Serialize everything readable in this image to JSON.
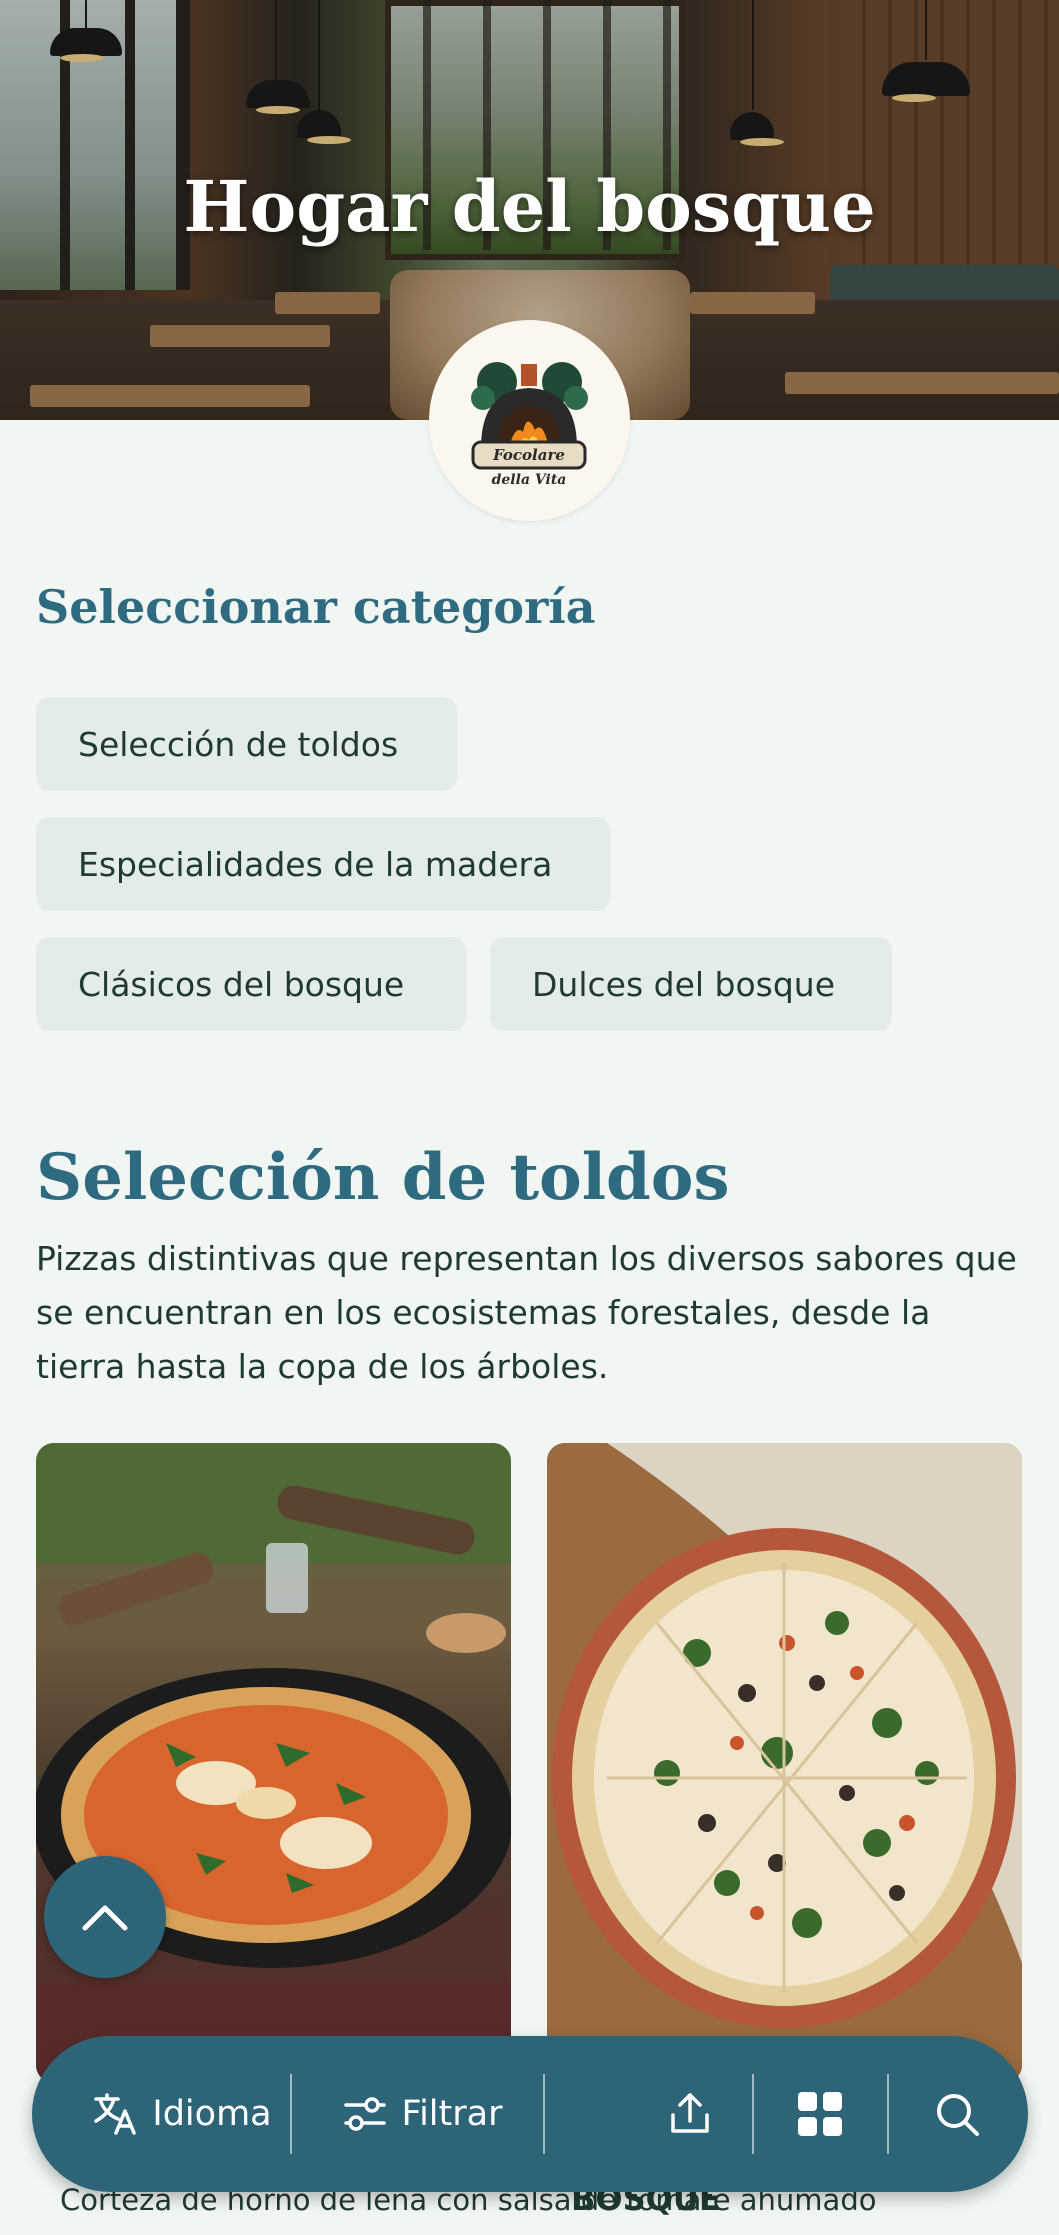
{
  "hero": {
    "title": "Hogar del bosque"
  },
  "logo": {
    "line1": "Focolare",
    "line2": "della Vita"
  },
  "categories": {
    "heading": "Seleccionar categoría",
    "items": [
      "Selección de toldos",
      "Especialidades de la madera",
      "Clásicos del bosque",
      "Dulces del bosque"
    ]
  },
  "section": {
    "title": "Selección de toldos",
    "description": "Pizzas distintivas que representan los diversos sabores que se encuentran en los ecosistemas forestales, desde la tierra hasta la copa de los árboles."
  },
  "cards": [
    {
      "text": "Corteza de horno de leña con salsa de tomate ahumado"
    },
    {
      "text": "BOSQUE"
    }
  ],
  "bottom_bar": {
    "language_label": "Idioma",
    "filter_label": "Filtrar",
    "icons": [
      "translate-icon",
      "filter-icon",
      "share-icon",
      "grid-icon",
      "search-icon"
    ]
  },
  "colors": {
    "primary": "#2e6478",
    "heading": "#2e6b80",
    "background": "#f1f6f3",
    "chip": "#e4ece8"
  }
}
